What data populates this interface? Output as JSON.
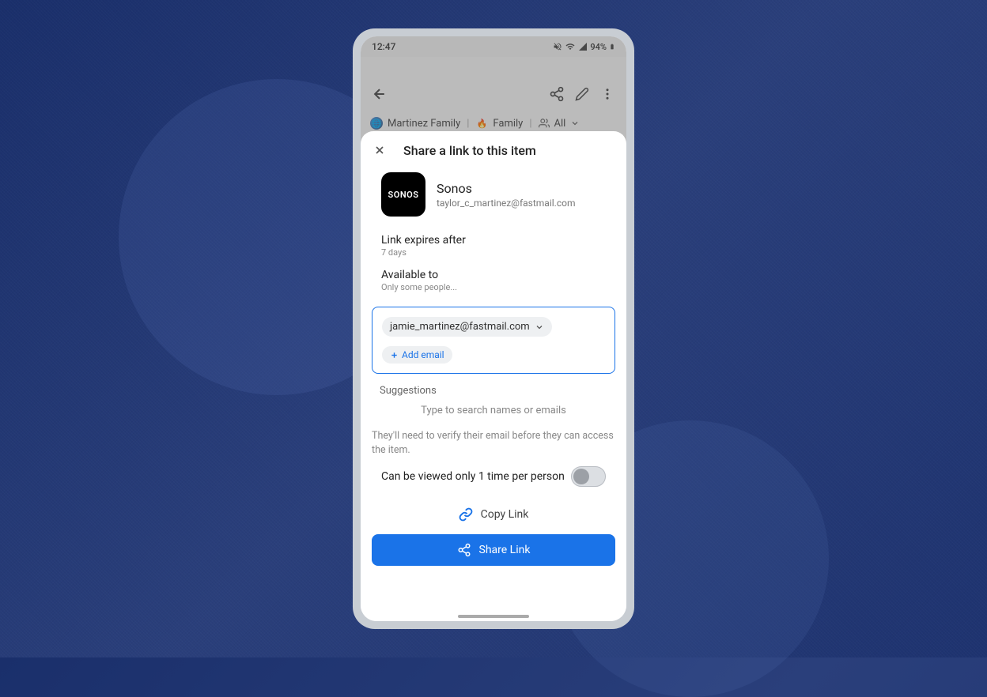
{
  "status": {
    "time": "12:47",
    "battery": "94%"
  },
  "breadcrumb": {
    "item1": "Martinez Family",
    "item2": "Family",
    "item3": "All"
  },
  "sheet": {
    "title": "Share a link to this item",
    "item_icon_text": "SONOS",
    "item_name": "Sonos",
    "item_email": "taylor_c_martinez@fastmail.com",
    "expires_label": "Link expires after",
    "expires_value": "7 days",
    "available_label": "Available to",
    "available_value": "Only some people...",
    "email_chip": "jamie_martinez@fastmail.com",
    "add_email": "Add email",
    "suggestions_label": "Suggestions",
    "search_hint": "Type to search names or emails",
    "verify_text": "They'll need to verify their email before they can access the item.",
    "toggle_label": "Can be viewed only 1 time per person",
    "copy_link": "Copy Link",
    "share_link": "Share Link"
  }
}
